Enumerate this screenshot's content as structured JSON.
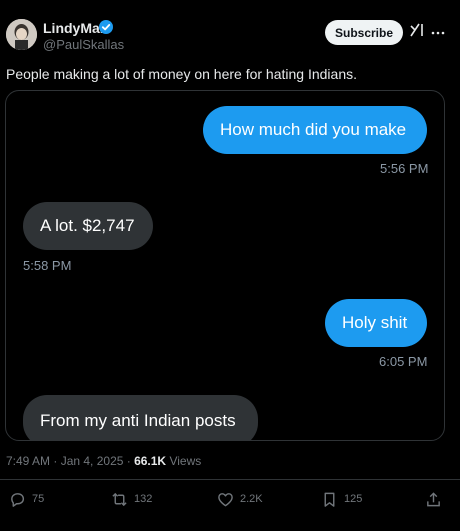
{
  "author": {
    "display_name": "LindyMan",
    "handle": "@PaulSkallas"
  },
  "header": {
    "subscribe_label": "Subscribe"
  },
  "tweet": {
    "text": "People making a lot of money on here for hating Indians."
  },
  "chat": {
    "messages": [
      {
        "text": "How much did you make",
        "time": "5:56 PM",
        "side": "sent"
      },
      {
        "text": "A lot. $2,747",
        "time": "5:58 PM",
        "side": "received"
      },
      {
        "text": "Holy shit",
        "time": "6:05 PM",
        "side": "sent"
      },
      {
        "text": "From my anti Indian posts",
        "time": "",
        "side": "received"
      }
    ]
  },
  "meta": {
    "timestamp": "7:49 AM · Jan 4, 2025 · ",
    "views_count": "66.1K",
    "views_label": " Views"
  },
  "actions": {
    "replies": "75",
    "reposts": "132",
    "likes": "2.2K",
    "bookmarks": "125"
  },
  "colors": {
    "accent": "#1d9bf0",
    "verified": "#1d9bf0",
    "received_bubble": "#2f3336"
  },
  "icons": [
    "avatar",
    "verified-badge-icon",
    "grok-icon",
    "more-icon",
    "reply-icon",
    "repost-icon",
    "like-icon",
    "bookmark-icon",
    "share-icon"
  ]
}
